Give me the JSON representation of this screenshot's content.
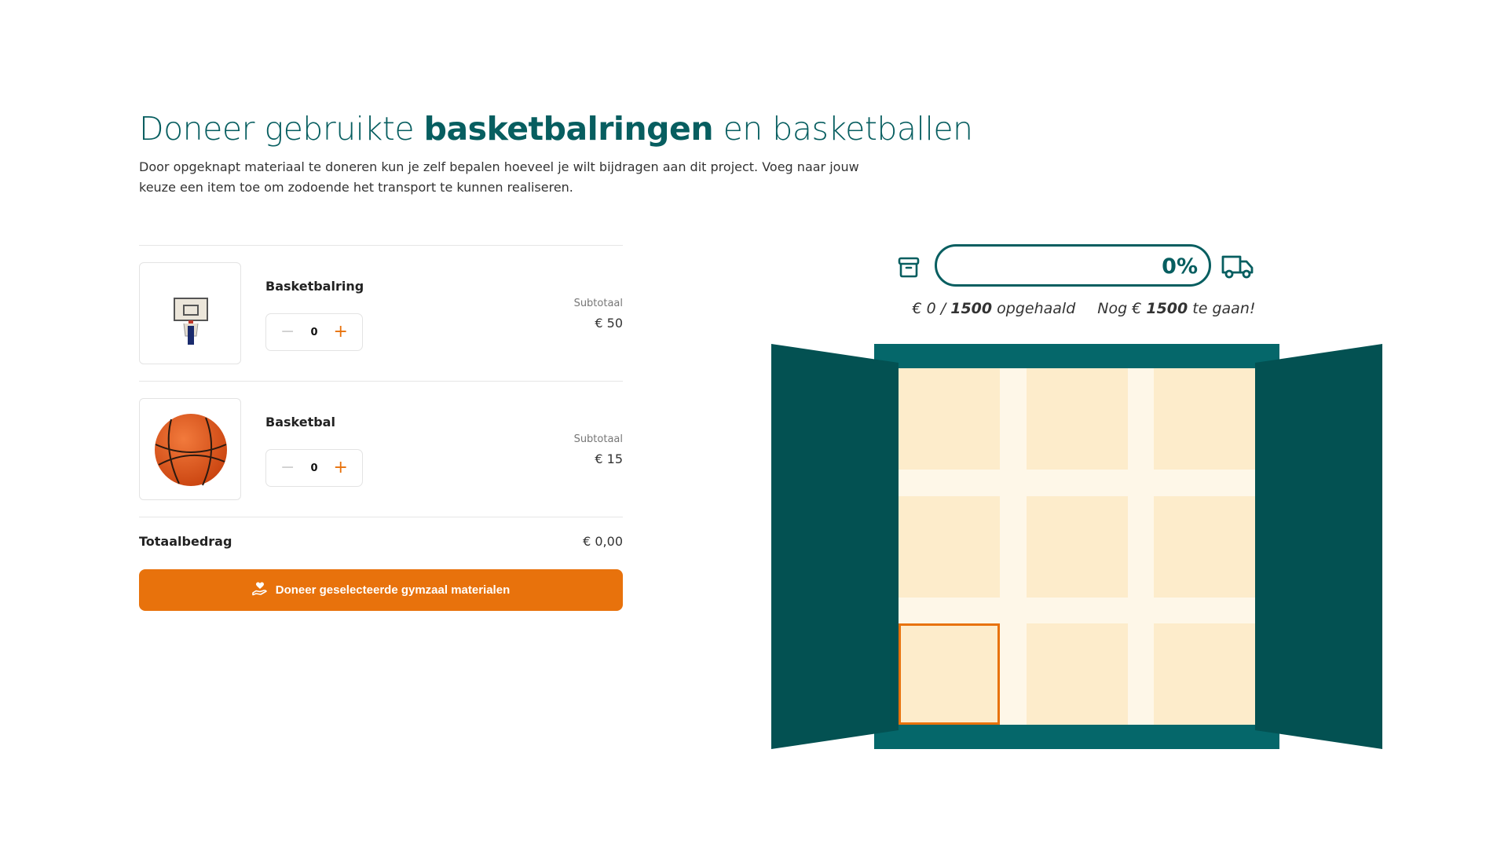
{
  "header": {
    "title_pre": "Doneer gebruikte ",
    "title_bold": "basketbalringen",
    "title_post": " en basketballen",
    "intro": "Door opgeknapt materiaal te doneren kun je zelf bepalen hoeveel je wilt bijdragen aan dit project. Voeg naar jouw keuze een item toe om zodoende het transport te kunnen realiseren."
  },
  "items": [
    {
      "name": "Basketbalring",
      "quantity": "0",
      "minus": "−",
      "plus": "+",
      "subtotal_label": "Subtotaal",
      "subtotal": "€ 50",
      "image": "basketball-hoop"
    },
    {
      "name": "Basketbal",
      "quantity": "0",
      "minus": "−",
      "plus": "+",
      "subtotal_label": "Subtotaal",
      "subtotal": "€ 15",
      "image": "basketball"
    }
  ],
  "total": {
    "label": "Totaalbedrag",
    "value": "€ 0,00"
  },
  "donate_button": {
    "label": "Doneer geselecteerde gymzaal materialen",
    "icon": "heart-hand-icon"
  },
  "progress": {
    "percent_label": "0%",
    "percent": 0,
    "start_icon": "box-icon",
    "end_icon": "truck-icon",
    "raised_pre": "€ 0 / ",
    "goal": "1500",
    "raised_post": " opgehaald",
    "remaining_pre": "Nog € ",
    "remaining": "1500",
    "remaining_post": " te gaan!"
  },
  "colors": {
    "brand": "#075e60",
    "accent": "#e8720c",
    "container": "#035152",
    "container_frame": "#05676a",
    "crate": "#fdeccb",
    "crate_gap": "#fef7e8"
  }
}
